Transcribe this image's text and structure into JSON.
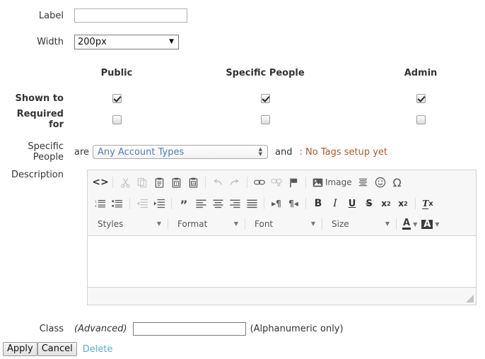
{
  "fields": {
    "label": {
      "label": "Label",
      "value": "",
      "placeholder": ""
    },
    "width": {
      "label": "Width",
      "value": "200px"
    },
    "specific_people": {
      "label": "Specific People"
    },
    "description": {
      "label": "Description"
    },
    "class": {
      "label": "Class",
      "advanced_note": "(Advanced)",
      "value": "",
      "hint": "(Alphanumeric only)"
    }
  },
  "permissions": {
    "columns": [
      "Public",
      "Specific People",
      "Admin"
    ],
    "rows": [
      {
        "label": "Shown to",
        "checked": [
          true,
          true,
          true
        ]
      },
      {
        "label": "Required for",
        "checked": [
          false,
          false,
          false
        ]
      }
    ]
  },
  "specific_people_row": {
    "are_word": "are",
    "selected_account_type": "Any Account Types",
    "and_word": "and",
    "tags_note": ": No Tags setup yet"
  },
  "editor": {
    "toolbar_row1": [
      {
        "name": "source-icon",
        "glyph": "<>",
        "dim": false
      },
      {
        "name": "separator",
        "glyph": "|",
        "dim": false
      },
      {
        "name": "cut-icon",
        "glyph": "scissors",
        "dim": true
      },
      {
        "name": "copy-icon",
        "glyph": "copy",
        "dim": true
      },
      {
        "name": "paste-icon",
        "glyph": "paste",
        "dim": false
      },
      {
        "name": "paste-as-text-icon",
        "glyph": "paste-t",
        "dim": false
      },
      {
        "name": "paste-from-word-icon",
        "glyph": "paste-w",
        "dim": false
      },
      {
        "name": "separator",
        "glyph": "|",
        "dim": false
      },
      {
        "name": "undo-icon",
        "glyph": "undo",
        "dim": true
      },
      {
        "name": "redo-icon",
        "glyph": "redo",
        "dim": true
      },
      {
        "name": "separator",
        "glyph": "|",
        "dim": false
      },
      {
        "name": "link-icon",
        "glyph": "link",
        "dim": false
      },
      {
        "name": "unlink-icon",
        "glyph": "unlink",
        "dim": true
      },
      {
        "name": "anchor-flag-icon",
        "glyph": "flag",
        "dim": false
      },
      {
        "name": "separator",
        "glyph": "|",
        "dim": false
      },
      {
        "name": "image-button",
        "glyph": "image",
        "dim": false,
        "label": "Image"
      },
      {
        "name": "horizontal-rule-icon",
        "glyph": "hr",
        "dim": false
      },
      {
        "name": "smiley-icon",
        "glyph": "smiley",
        "dim": false
      },
      {
        "name": "special-char-icon",
        "glyph": "omega",
        "dim": false
      }
    ],
    "toolbar_row2": [
      {
        "name": "numbered-list-icon",
        "glyph": "ol",
        "dim": false
      },
      {
        "name": "bulleted-list-icon",
        "glyph": "ul",
        "dim": false
      },
      {
        "name": "separator",
        "glyph": "|",
        "dim": false
      },
      {
        "name": "outdent-icon",
        "glyph": "outdent",
        "dim": true
      },
      {
        "name": "indent-icon",
        "glyph": "indent",
        "dim": false
      },
      {
        "name": "separator",
        "glyph": "|",
        "dim": false
      },
      {
        "name": "blockquote-icon",
        "glyph": "quote",
        "dim": false
      },
      {
        "name": "align-left-icon",
        "glyph": "al",
        "dim": false
      },
      {
        "name": "align-center-icon",
        "glyph": "ac",
        "dim": false
      },
      {
        "name": "align-right-icon",
        "glyph": "ar",
        "dim": false
      },
      {
        "name": "align-justify-icon",
        "glyph": "aj",
        "dim": false
      },
      {
        "name": "separator",
        "glyph": "|",
        "dim": false
      },
      {
        "name": "ltr-icon",
        "glyph": "ltr",
        "dim": false
      },
      {
        "name": "rtl-icon",
        "glyph": "rtl",
        "dim": false
      },
      {
        "name": "separator",
        "glyph": "|",
        "dim": false
      },
      {
        "name": "bold-icon",
        "glyph": "B",
        "dim": false
      },
      {
        "name": "italic-icon",
        "glyph": "I",
        "dim": false
      },
      {
        "name": "underline-icon",
        "glyph": "U",
        "dim": false
      },
      {
        "name": "strikethrough-icon",
        "glyph": "S",
        "dim": false
      },
      {
        "name": "subscript-icon",
        "glyph": "sub",
        "dim": false
      },
      {
        "name": "superscript-icon",
        "glyph": "sup",
        "dim": false
      },
      {
        "name": "separator",
        "glyph": "|",
        "dim": false
      },
      {
        "name": "remove-format-icon",
        "glyph": "Tx",
        "dim": false
      }
    ],
    "toolbar_row3": {
      "styles_label": "Styles",
      "format_label": "Format",
      "font_label": "Font",
      "size_label": "Size",
      "text_color_name": "text-color-icon",
      "bg_color_name": "background-color-icon"
    },
    "content": ""
  },
  "buttons": {
    "apply": "Apply",
    "cancel": "Cancel",
    "delete": "Delete"
  },
  "colors": {
    "link": "#4fb6d6",
    "select_text": "#4a7ebb",
    "tag_note": "#b15a28",
    "toolbar_bg": "#f7f7f7",
    "border": "#d1d1d1"
  }
}
